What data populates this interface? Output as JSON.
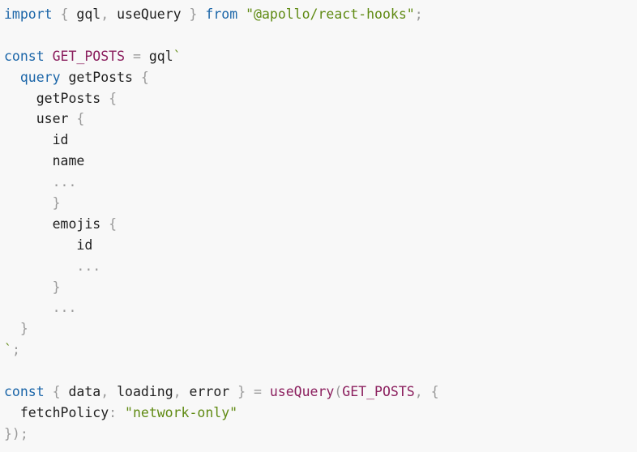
{
  "code": {
    "language": "javascript",
    "lines": [
      [
        {
          "t": "import",
          "c": "k"
        },
        {
          "t": " ",
          "c": "t"
        },
        {
          "t": "{",
          "c": "p"
        },
        {
          "t": " gql",
          "c": "t"
        },
        {
          "t": ",",
          "c": "p"
        },
        {
          "t": " useQuery ",
          "c": "t"
        },
        {
          "t": "}",
          "c": "p"
        },
        {
          "t": " ",
          "c": "t"
        },
        {
          "t": "from",
          "c": "k"
        },
        {
          "t": " ",
          "c": "t"
        },
        {
          "t": "\"@apollo/react-hooks\"",
          "c": "s"
        },
        {
          "t": ";",
          "c": "p"
        }
      ],
      [],
      [
        {
          "t": "const",
          "c": "k"
        },
        {
          "t": " ",
          "c": "t"
        },
        {
          "t": "GET_POSTS",
          "c": "v"
        },
        {
          "t": " ",
          "c": "t"
        },
        {
          "t": "=",
          "c": "p"
        },
        {
          "t": " gql",
          "c": "t"
        },
        {
          "t": "`",
          "c": "s"
        }
      ],
      [
        {
          "t": "  ",
          "c": "t"
        },
        {
          "t": "query",
          "c": "k"
        },
        {
          "t": " getPosts ",
          "c": "t"
        },
        {
          "t": "{",
          "c": "p"
        }
      ],
      [
        {
          "t": "    getPosts ",
          "c": "t"
        },
        {
          "t": "{",
          "c": "p"
        }
      ],
      [
        {
          "t": "    user ",
          "c": "t"
        },
        {
          "t": "{",
          "c": "p"
        }
      ],
      [
        {
          "t": "      id",
          "c": "t"
        }
      ],
      [
        {
          "t": "      name",
          "c": "t"
        }
      ],
      [
        {
          "t": "      ",
          "c": "t"
        },
        {
          "t": "...",
          "c": "p"
        }
      ],
      [
        {
          "t": "      ",
          "c": "t"
        },
        {
          "t": "}",
          "c": "p"
        }
      ],
      [
        {
          "t": "      emojis ",
          "c": "t"
        },
        {
          "t": "{",
          "c": "p"
        }
      ],
      [
        {
          "t": "         id",
          "c": "t"
        }
      ],
      [
        {
          "t": "         ",
          "c": "t"
        },
        {
          "t": "...",
          "c": "p"
        }
      ],
      [
        {
          "t": "      ",
          "c": "t"
        },
        {
          "t": "}",
          "c": "p"
        }
      ],
      [
        {
          "t": "      ",
          "c": "t"
        },
        {
          "t": "...",
          "c": "p"
        }
      ],
      [
        {
          "t": "  ",
          "c": "t"
        },
        {
          "t": "}",
          "c": "p"
        }
      ],
      [
        {
          "t": "`",
          "c": "s"
        },
        {
          "t": ";",
          "c": "p"
        }
      ],
      [],
      [
        {
          "t": "const",
          "c": "k"
        },
        {
          "t": " ",
          "c": "t"
        },
        {
          "t": "{",
          "c": "p"
        },
        {
          "t": " data",
          "c": "t"
        },
        {
          "t": ",",
          "c": "p"
        },
        {
          "t": " loading",
          "c": "t"
        },
        {
          "t": ",",
          "c": "p"
        },
        {
          "t": " error ",
          "c": "t"
        },
        {
          "t": "}",
          "c": "p"
        },
        {
          "t": " ",
          "c": "t"
        },
        {
          "t": "=",
          "c": "p"
        },
        {
          "t": " ",
          "c": "t"
        },
        {
          "t": "useQuery",
          "c": "v"
        },
        {
          "t": "(",
          "c": "p"
        },
        {
          "t": "GET_POSTS",
          "c": "v"
        },
        {
          "t": ",",
          "c": "p"
        },
        {
          "t": " ",
          "c": "t"
        },
        {
          "t": "{",
          "c": "p"
        }
      ],
      [
        {
          "t": "  fetchPolicy",
          "c": "t"
        },
        {
          "t": ":",
          "c": "p"
        },
        {
          "t": " ",
          "c": "t"
        },
        {
          "t": "\"network-only\"",
          "c": "s"
        }
      ],
      [
        {
          "t": "});",
          "c": "p"
        }
      ]
    ]
  },
  "colors": {
    "background": "#f8f8f8",
    "keyword": "#1a65a8",
    "identifier": "#8b1f5e",
    "string": "#5f8a12",
    "punctuation": "#9a9a9a",
    "text": "#1f1f1f"
  }
}
